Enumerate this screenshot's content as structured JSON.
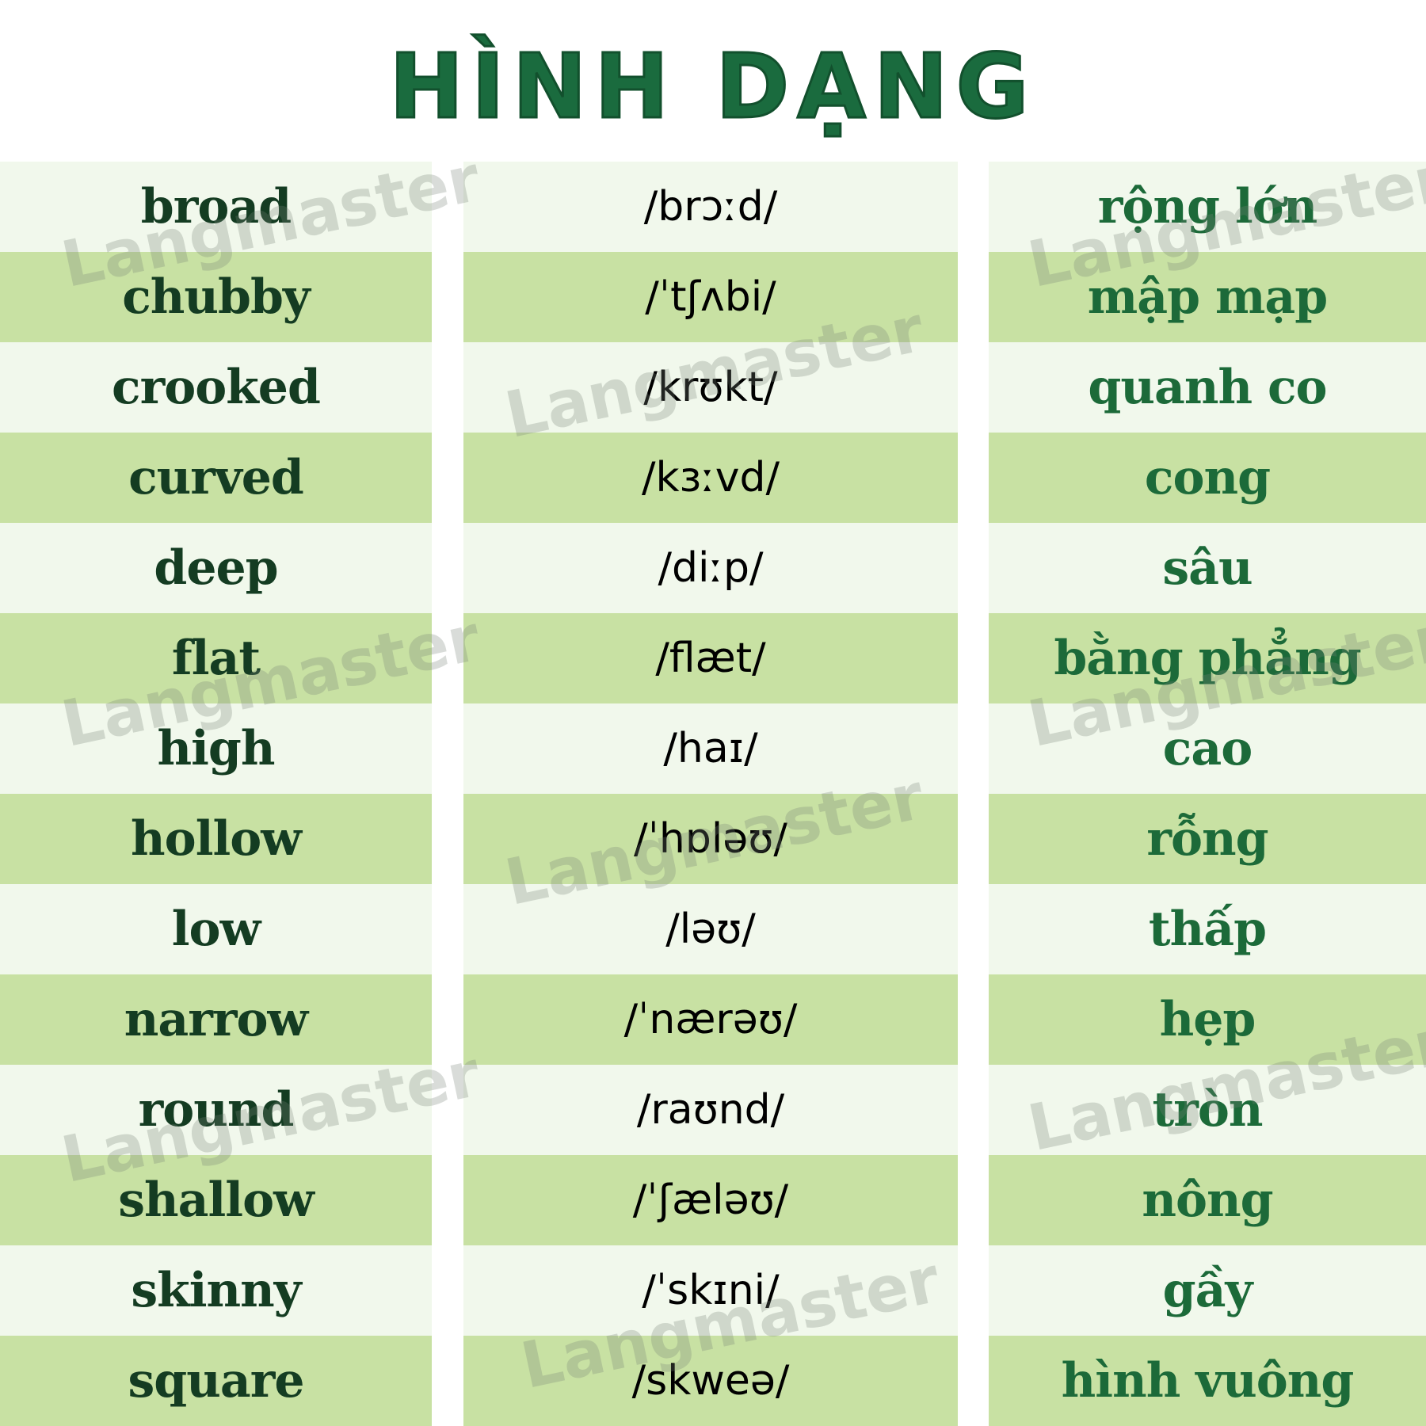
{
  "title": "HÌNH DẠNG",
  "watermark": "Langmaster",
  "rows": [
    {
      "en": "broad",
      "ipa": "/brɔːd/",
      "vi": "rộng lớn"
    },
    {
      "en": "chubby",
      "ipa": "/ˈtʃʌbi/",
      "vi": "mập mạp"
    },
    {
      "en": "crooked",
      "ipa": "/krʊkt/",
      "vi": "quanh co"
    },
    {
      "en": "curved",
      "ipa": "/kɜːvd/",
      "vi": "cong"
    },
    {
      "en": "deep",
      "ipa": "/diːp/",
      "vi": "sâu"
    },
    {
      "en": "flat",
      "ipa": "/flæt/",
      "vi": "bằng phẳng"
    },
    {
      "en": "high",
      "ipa": "/haɪ/",
      "vi": "cao"
    },
    {
      "en": "hollow",
      "ipa": "/ˈhɒləʊ/",
      "vi": "rỗng"
    },
    {
      "en": "low",
      "ipa": "/ləʊ/",
      "vi": "thấp"
    },
    {
      "en": "narrow",
      "ipa": "/ˈnærəʊ/",
      "vi": "hẹp"
    },
    {
      "en": "round",
      "ipa": "/raʊnd/",
      "vi": "tròn"
    },
    {
      "en": "shallow",
      "ipa": "/ˈʃæləʊ/",
      "vi": "nông"
    },
    {
      "en": "skinny",
      "ipa": "/ˈskɪni/",
      "vi": "gầy"
    },
    {
      "en": "square",
      "ipa": "/skweə/",
      "vi": "hình vuông"
    }
  ]
}
